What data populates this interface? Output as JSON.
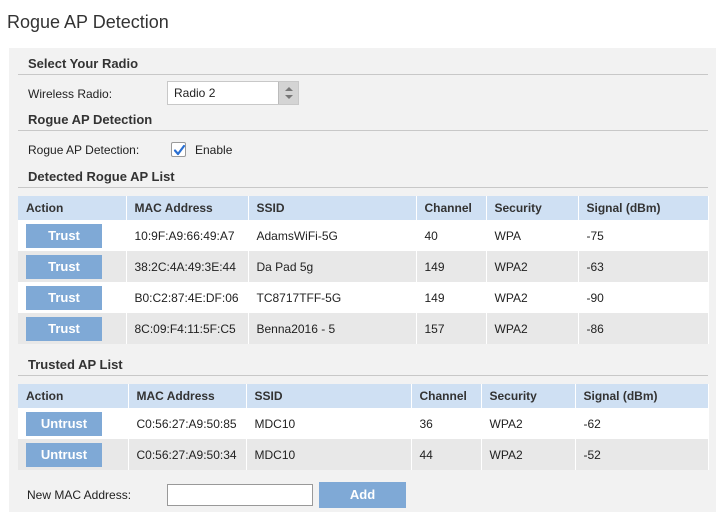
{
  "page": {
    "title": "Rogue AP Detection"
  },
  "radio_section": {
    "heading": "Select Your Radio",
    "label": "Wireless Radio:",
    "selected": "Radio 2"
  },
  "detection_section": {
    "heading": "Rogue AP Detection",
    "label": "Rogue AP Detection:",
    "checkbox_label": "Enable",
    "enabled": true
  },
  "rogue_list": {
    "heading": "Detected Rogue AP List",
    "columns": [
      "Action",
      "MAC Address",
      "SSID",
      "Channel",
      "Security",
      "Signal (dBm)"
    ],
    "button_label": "Trust",
    "rows": [
      {
        "mac": "10:9F:A9:66:49:A7",
        "ssid": "AdamsWiFi-5G",
        "channel": "40",
        "security": "WPA",
        "signal": "-75"
      },
      {
        "mac": "38:2C:4A:49:3E:44",
        "ssid": "Da Pad 5g",
        "channel": "149",
        "security": "WPA2",
        "signal": "-63"
      },
      {
        "mac": "B0:C2:87:4E:DF:06",
        "ssid": "TC8717TFF-5G",
        "channel": "149",
        "security": "WPA2",
        "signal": "-90"
      },
      {
        "mac": "8C:09:F4:11:5F:C5",
        "ssid": "Benna2016 - 5",
        "channel": "157",
        "security": "WPA2",
        "signal": "-86"
      }
    ]
  },
  "trusted_list": {
    "heading": "Trusted AP List",
    "columns": [
      "Action",
      "MAC Address",
      "SSID",
      "Channel",
      "Security",
      "Signal (dBm)"
    ],
    "button_label": "Untrust",
    "rows": [
      {
        "mac": "C0:56:27:A9:50:85",
        "ssid": "MDC10",
        "channel": "36",
        "security": "WPA2",
        "signal": "-62"
      },
      {
        "mac": "C0:56:27:A9:50:34",
        "ssid": "MDC10",
        "channel": "44",
        "security": "WPA2",
        "signal": "-52"
      }
    ]
  },
  "new_mac": {
    "label": "New MAC Address:",
    "value": "",
    "button_label": "Add"
  },
  "colors": {
    "header_bg": "#cfe0f3",
    "button_bg": "#7fa9d6",
    "panel_bg": "#f2f2f2",
    "row_alt_bg": "#e8e8e8",
    "check_color": "#2a6fd1"
  }
}
